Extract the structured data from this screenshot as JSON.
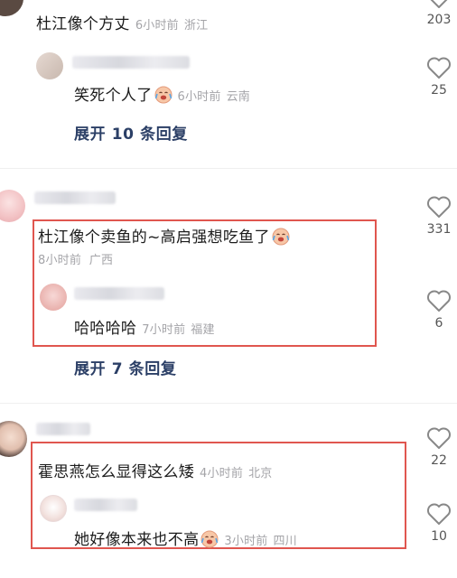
{
  "comments": [
    {
      "text": "杜江像个方丈",
      "time": "6小时前",
      "location": "浙江",
      "likes": "203",
      "reply": {
        "text": "笑死个人了",
        "time": "6小时前",
        "location": "云南",
        "likes": "25"
      },
      "expand_label": "展开 10 条回复"
    },
    {
      "text": "杜江像个卖鱼的~高启强想吃鱼了",
      "time": "8小时前",
      "location": "广西",
      "likes": "331",
      "reply": {
        "text": "哈哈哈哈",
        "time": "7小时前",
        "location": "福建",
        "likes": "6"
      },
      "expand_label": "展开 7 条回复"
    },
    {
      "text": "霍思燕怎么显得这么矮",
      "time": "4小时前",
      "location": "北京",
      "likes": "22",
      "reply": {
        "text": "她好像本来也不高",
        "time": "3小时前",
        "location": "四川",
        "likes": "10"
      }
    }
  ],
  "colors": {
    "highlight_box": "#e0564f",
    "expand_text": "#2b3f66",
    "meta_text": "#a4a4a8"
  },
  "icons": {
    "like": "heart-outline-icon",
    "emoji": "crying-laughing-emoji-icon"
  }
}
